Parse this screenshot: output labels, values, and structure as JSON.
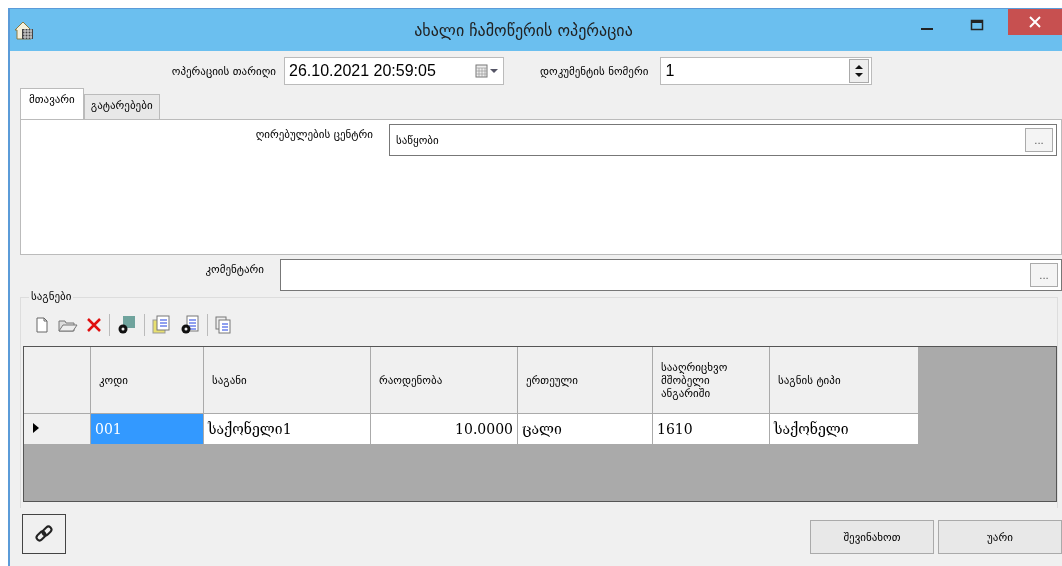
{
  "window": {
    "title": "ახალი ჩამოწერის ოპერაცია"
  },
  "header": {
    "date_label": "ოპერაციის თარიღი",
    "date_value": "26.10.2021 20:59:05",
    "number_label": "დოკუმენტის ნომერი",
    "number_value": "1"
  },
  "tabs": [
    {
      "label": "მთავარი",
      "selected": true
    },
    {
      "label": "გატარებები",
      "selected": false
    }
  ],
  "main_tab": {
    "cost_center_label": "ღირებულების ცენტრი",
    "cost_center_value": "საწყობი",
    "browse": "..."
  },
  "comment": {
    "label": "კომენტარი",
    "browse": "..."
  },
  "items": {
    "title": "საგნები",
    "columns": [
      {
        "label": "კოდი",
        "kind": "text"
      },
      {
        "label": "საგანი",
        "kind": "text"
      },
      {
        "label": "რაოდენობა",
        "kind": "number"
      },
      {
        "label": "ერთეული",
        "kind": "text"
      },
      {
        "label": "სააღრიცხვო მშობელი ანგარიში",
        "kind": "text"
      },
      {
        "label": "საგნის ტიპი",
        "kind": "text"
      }
    ],
    "rows": [
      {
        "current": true,
        "cells": [
          {
            "text": "001",
            "selected": true
          },
          {
            "text": "საქონელი1",
            "selected": false
          },
          {
            "text": "10.0000",
            "selected": false
          },
          {
            "text": "ცალი",
            "selected": false
          },
          {
            "text": "1610",
            "selected": false
          },
          {
            "text": "საქონელი",
            "selected": false
          }
        ]
      }
    ]
  },
  "buttons": [
    {
      "label": "შევინახოთ"
    },
    {
      "label": "უარი"
    }
  ]
}
